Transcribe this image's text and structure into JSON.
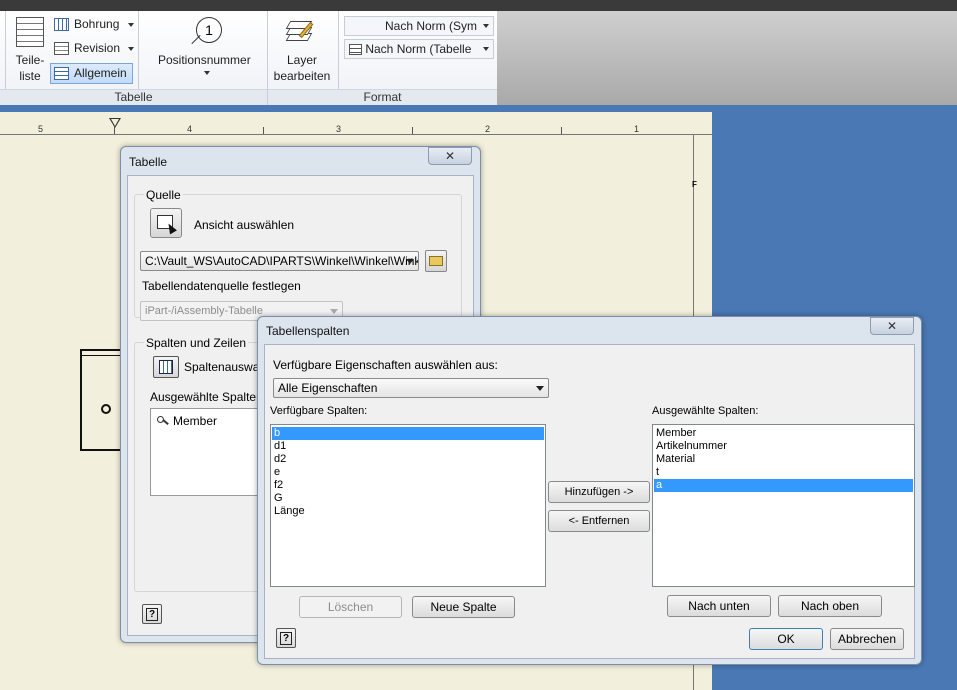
{
  "ribbon": {
    "parts_list_label": "Teile-\nliste",
    "parts_list_line1": "Teile-",
    "parts_list_line2": "liste",
    "hole_label": "Bohrung",
    "revision_label": "Revision",
    "general_label": "Allgemein",
    "balloon_label": "Positionsnummer",
    "balloon_number": "1",
    "layer_line1": "Layer",
    "layer_line2": "bearbeiten",
    "style_combo1": "Nach Norm (Sym",
    "style_combo2": "Nach Norm (Tabelle",
    "group_table": "Tabelle",
    "group_format": "Format"
  },
  "ruler": {
    "numbers": [
      "5",
      "4",
      "3",
      "2",
      "1"
    ],
    "border_letter": "F"
  },
  "table_dialog": {
    "title": "Tabelle",
    "close": "✕",
    "source_group": "Quelle",
    "select_view": "Ansicht auswählen",
    "file_path": "C:\\Vault_WS\\AutoCAD\\IPARTS\\Winkel\\Winkel\\Winkel",
    "datasource_label": "Tabellendatenquelle festlegen",
    "datasource_value": "iPart-/iAssembly-Tabelle",
    "columns_rows_group": "Spalten und Zeilen",
    "column_chooser": "Spaltenauswa",
    "selected_columns_label": "Ausgewählte Spalten",
    "selected_columns": [
      "Member"
    ],
    "help": "?"
  },
  "columns_dialog": {
    "title": "Tabellenspalten",
    "close": "✕",
    "props_from_label": "Verfügbare Eigenschaften auswählen aus:",
    "props_from_value": "Alle Eigenschaften",
    "available_label": "Verfügbare Spalten:",
    "available": [
      "b",
      "d1",
      "d2",
      "e",
      "f2",
      "G",
      "Länge"
    ],
    "available_selected": "b",
    "selected_label": "Ausgewählte Spalten:",
    "selected": [
      "Member",
      "Artikelnummer",
      "Material",
      "t",
      "a"
    ],
    "selected_selected": "a",
    "add_button": "Hinzufügen ->",
    "remove_button": "<- Entfernen",
    "delete_button": "Löschen",
    "new_column_button": "Neue Spalte",
    "move_down_button": "Nach unten",
    "move_up_button": "Nach oben",
    "ok_button": "OK",
    "cancel_button": "Abbrechen",
    "help": "?"
  },
  "colors": {
    "selection": "#3399ff",
    "desktop": "#4a78b4",
    "sheet": "#f2f0dc"
  }
}
